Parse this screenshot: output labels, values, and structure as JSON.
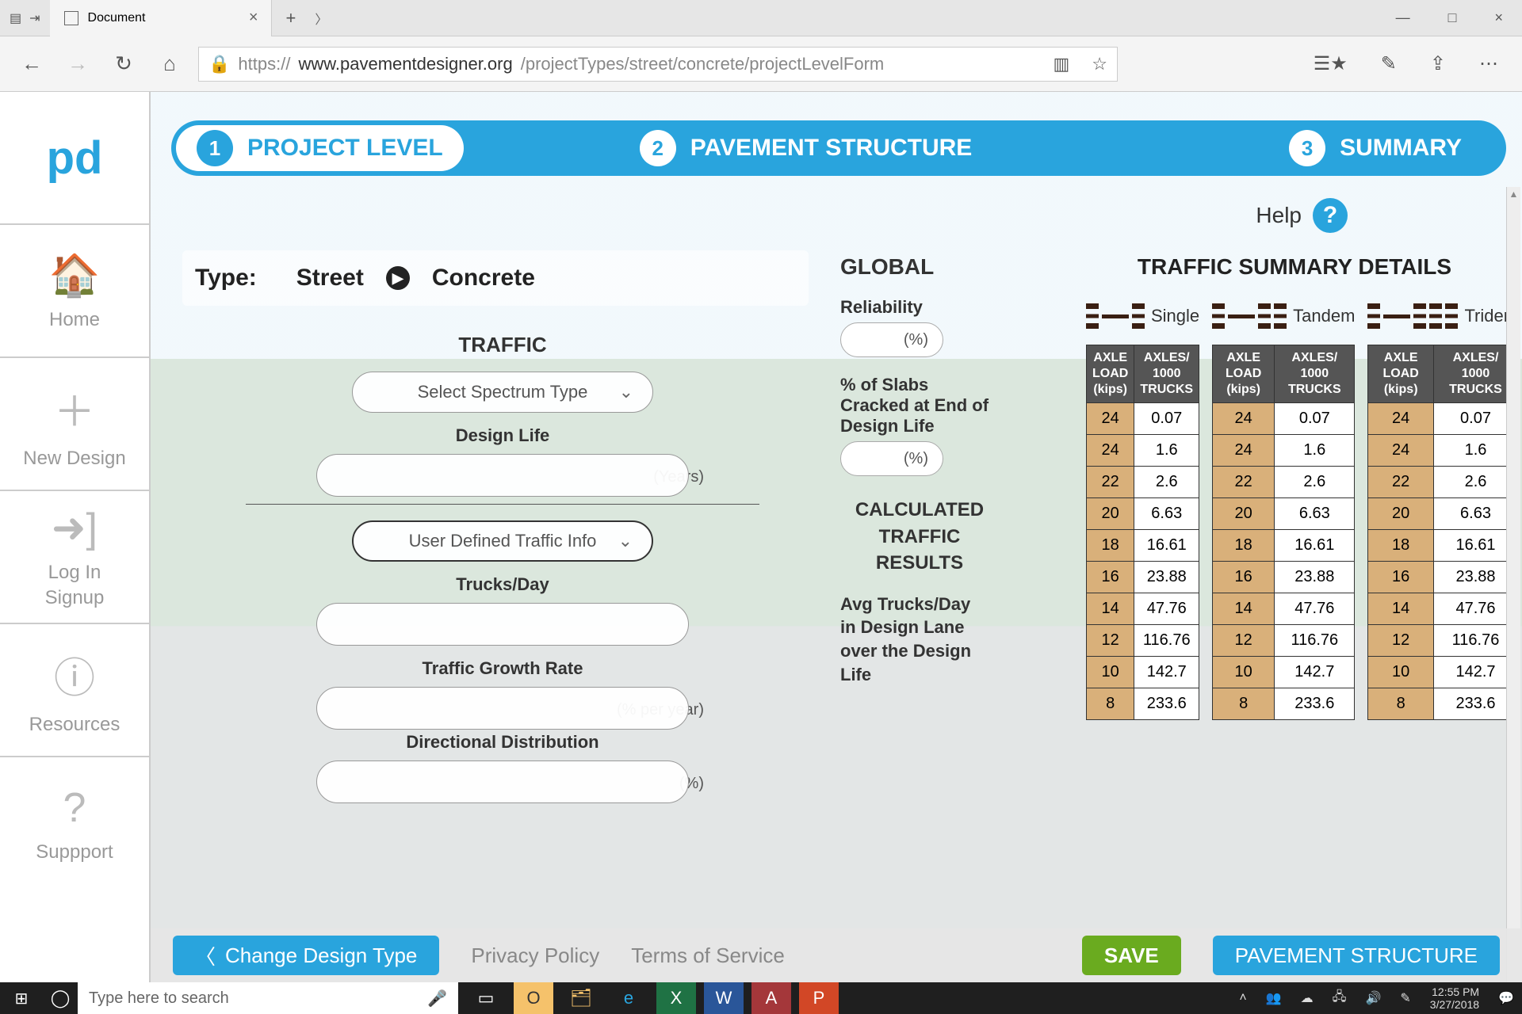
{
  "browser": {
    "tab_title": "Document",
    "url_proto": "https://",
    "url_host": "www.pavementdesigner.org",
    "url_path": "/projectTypes/street/concrete/projectLevelForm"
  },
  "steps": {
    "s1": "PROJECT LEVEL",
    "s2": "PAVEMENT STRUCTURE",
    "s3": "SUMMARY"
  },
  "help_label": "Help",
  "type_row": {
    "label": "Type:",
    "v1": "Street",
    "v2": "Concrete"
  },
  "sidebar": {
    "home": "Home",
    "new_design": "New Design",
    "login1": "Log In",
    "login2": "Signup",
    "resources": "Resources",
    "support": "Suppport"
  },
  "form": {
    "traffic_hdr": "TRAFFIC",
    "spectrum_placeholder": "Select Spectrum Type",
    "design_life_lbl": "Design Life",
    "design_life_units": "(Years)",
    "traffic_info_sel": "User Defined Traffic Info",
    "trucks_day_lbl": "Trucks/Day",
    "growth_lbl": "Traffic Growth Rate",
    "growth_units": "(% per year)",
    "dir_dist_lbl": "Directional Distribution",
    "dir_dist_units": "(%)"
  },
  "global": {
    "hdr": "GLOBAL",
    "reliability_lbl": "Reliability",
    "reliability_units": "(%)",
    "slabs_lbl": "% of Slabs Cracked at End of Design Life",
    "slabs_units": "(%)",
    "calc_hdr": "CALCULATED TRAFFIC RESULTS",
    "avg_lbl": "Avg Trucks/Day in Design Lane over the Design Life"
  },
  "summary_hdr": "TRAFFIC SUMMARY DETAILS",
  "axle_labels": {
    "single": "Single",
    "tandem": "Tandem",
    "tridem": "Tridem"
  },
  "table_headers": {
    "load": "AXLE LOAD (kips)",
    "per1000": "AXLES/ 1000 TRUCKS"
  },
  "chart_data": {
    "type": "table",
    "columns": [
      "axle_load_kips",
      "axles_per_1000_trucks"
    ],
    "single": [
      [
        24,
        0.07
      ],
      [
        24,
        1.6
      ],
      [
        22,
        2.6
      ],
      [
        20,
        6.63
      ],
      [
        18,
        16.61
      ],
      [
        16,
        23.88
      ],
      [
        14,
        47.76
      ],
      [
        12,
        116.76
      ],
      [
        10,
        142.7
      ],
      [
        8,
        233.6
      ]
    ],
    "tandem": [
      [
        24,
        0.07
      ],
      [
        24,
        1.6
      ],
      [
        22,
        2.6
      ],
      [
        20,
        6.63
      ],
      [
        18,
        16.61
      ],
      [
        16,
        23.88
      ],
      [
        14,
        47.76
      ],
      [
        12,
        116.76
      ],
      [
        10,
        142.7
      ],
      [
        8,
        233.6
      ]
    ],
    "tridem": [
      [
        24,
        0.07
      ],
      [
        24,
        1.6
      ],
      [
        22,
        2.6
      ],
      [
        20,
        6.63
      ],
      [
        18,
        16.61
      ],
      [
        16,
        23.88
      ],
      [
        14,
        47.76
      ],
      [
        12,
        116.76
      ],
      [
        10,
        142.7
      ],
      [
        8,
        233.6
      ]
    ]
  },
  "actions": {
    "change_design": "Change Design Type",
    "privacy": "Privacy Policy",
    "tos": "Terms of Service",
    "save": "SAVE",
    "next": "PAVEMENT STRUCTURE"
  },
  "taskbar": {
    "search_placeholder": "Type here to search",
    "time": "12:55 PM",
    "date": "3/27/2018"
  }
}
